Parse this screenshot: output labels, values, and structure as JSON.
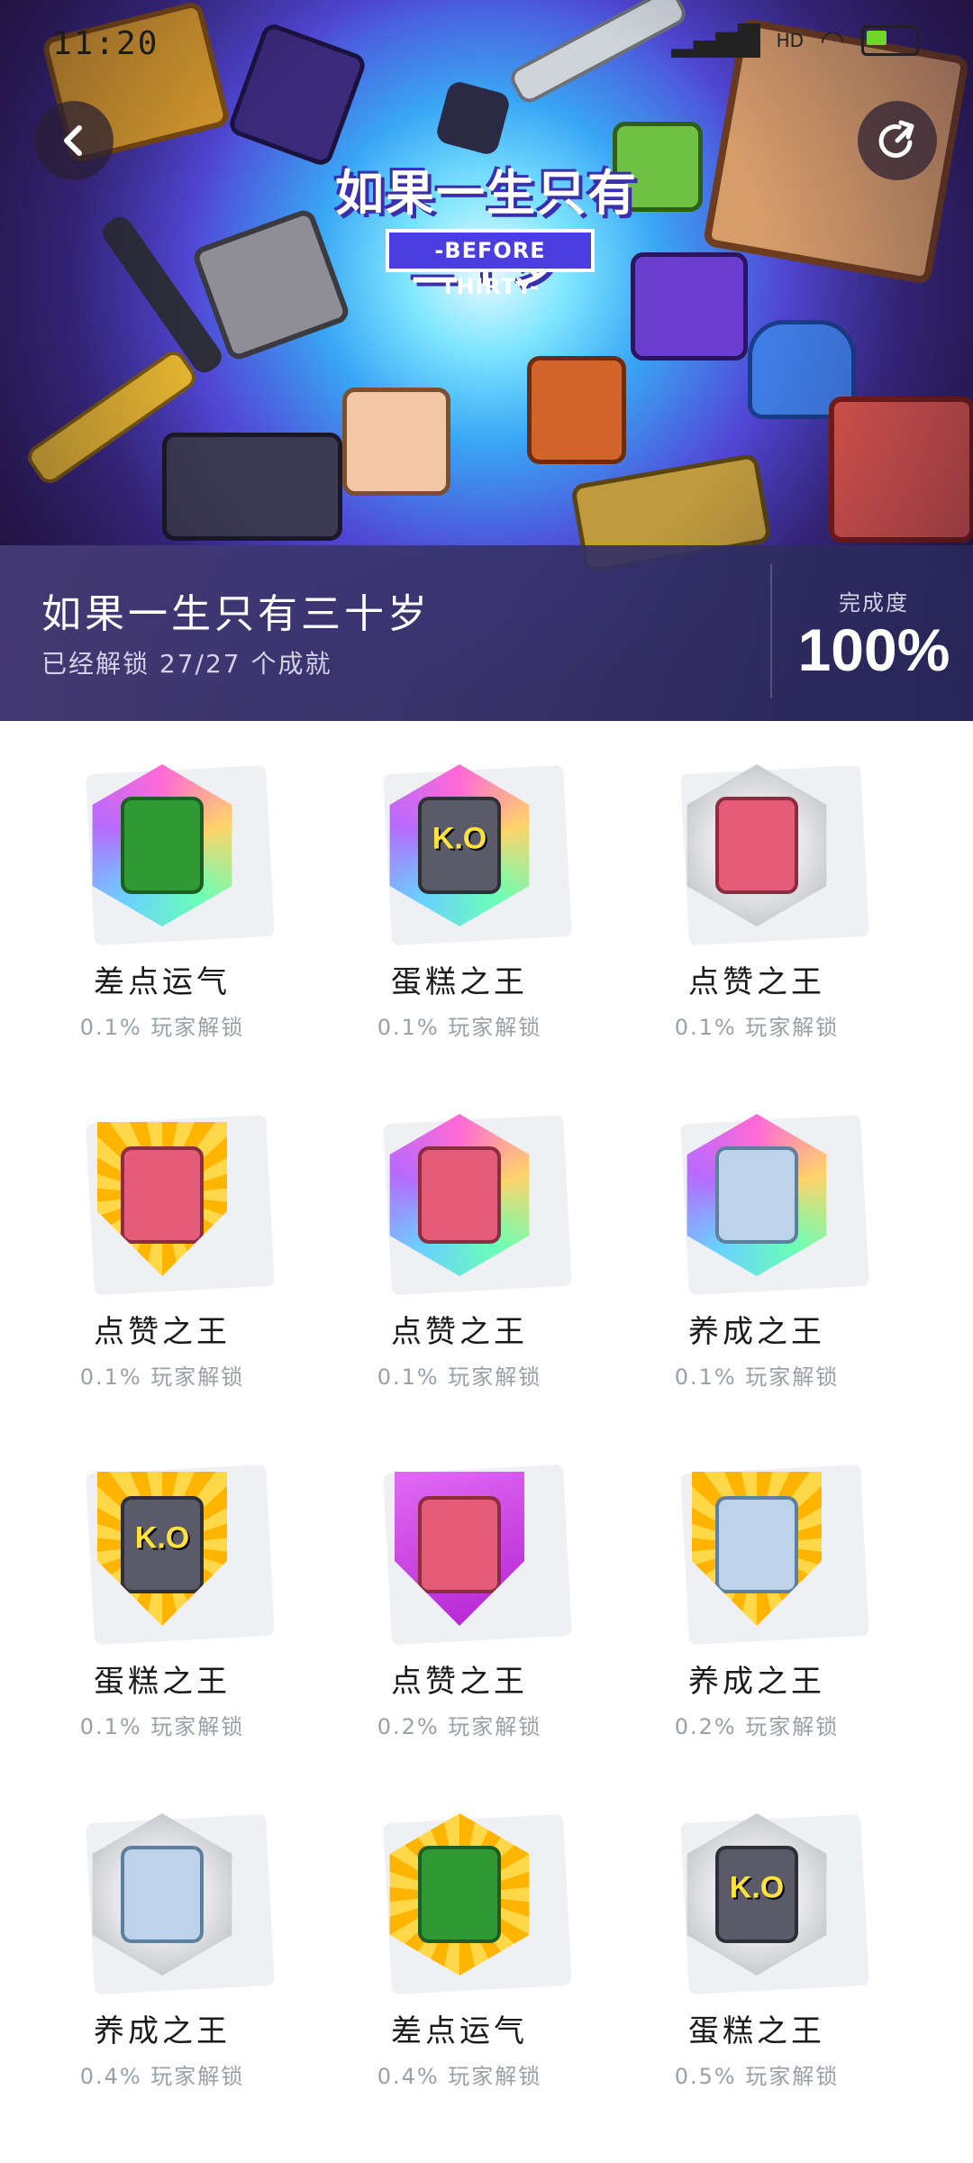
{
  "status_bar": {
    "time": "11:20",
    "network_label": "HD"
  },
  "hero": {
    "logo_cn": "如果一生只有三十岁",
    "logo_en": "-BEFORE THIRTY-",
    "game_title": "如果一生只有三十岁",
    "unlock_text": "已经解锁 27/27 个成就",
    "completion_label": "完成度",
    "completion_value": "100%"
  },
  "achievements": [
    {
      "name": "差点运气",
      "pct": "0.1% 玩家解锁",
      "shape": "hex",
      "style": "rainbow",
      "figure": "turtle"
    },
    {
      "name": "蛋糕之王",
      "pct": "0.1% 玩家解锁",
      "shape": "hex",
      "style": "rainbow",
      "figure": "ko"
    },
    {
      "name": "点赞之王",
      "pct": "0.1% 玩家解锁",
      "shape": "hex",
      "style": "silver",
      "figure": "girl"
    },
    {
      "name": "点赞之王",
      "pct": "0.1% 玩家解锁",
      "shape": "shield",
      "style": "gold",
      "figure": "girl"
    },
    {
      "name": "点赞之王",
      "pct": "0.1% 玩家解锁",
      "shape": "hex",
      "style": "rainbow",
      "figure": "girl"
    },
    {
      "name": "养成之王",
      "pct": "0.1% 玩家解锁",
      "shape": "hex",
      "style": "rainbow",
      "figure": "wolf"
    },
    {
      "name": "蛋糕之王",
      "pct": "0.1% 玩家解锁",
      "shape": "shield",
      "style": "gold",
      "figure": "ko"
    },
    {
      "name": "点赞之王",
      "pct": "0.2% 玩家解锁",
      "shape": "shield",
      "style": "purple",
      "figure": "girl"
    },
    {
      "name": "养成之王",
      "pct": "0.2% 玩家解锁",
      "shape": "shield",
      "style": "gold",
      "figure": "wolf"
    },
    {
      "name": "养成之王",
      "pct": "0.4% 玩家解锁",
      "shape": "hex",
      "style": "silver",
      "figure": "wolf"
    },
    {
      "name": "差点运气",
      "pct": "0.4% 玩家解锁",
      "shape": "hex",
      "style": "gold",
      "figure": "turtle"
    },
    {
      "name": "蛋糕之王",
      "pct": "0.5% 玩家解锁",
      "shape": "hex",
      "style": "silver",
      "figure": "ko"
    }
  ],
  "icons": {
    "back": "chevron-left-icon",
    "share": "share-icon"
  }
}
